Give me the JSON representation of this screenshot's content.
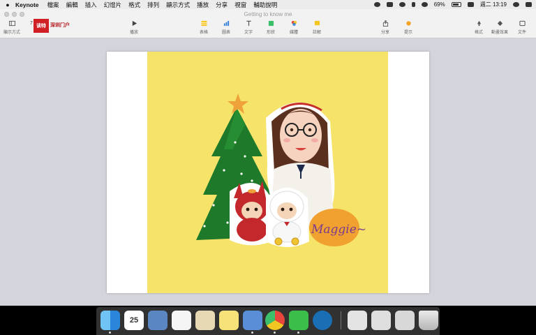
{
  "menubar": {
    "apple": "",
    "app": "Keynote",
    "menus": [
      "檔案",
      "編輯",
      "插入",
      "幻燈片",
      "格式",
      "排列",
      "顯示方式",
      "播放",
      "分享",
      "視窗",
      "輔助說明"
    ],
    "battery": "69%",
    "clock": "週二 13:19"
  },
  "window": {
    "title": "Getting to know me",
    "toolbar": {
      "view": "顯示方式",
      "play": "播放",
      "table": "表格",
      "chart": "圖表",
      "text": "文字",
      "shape": "形狀",
      "media": "媒體",
      "comment": "註解",
      "share": "分享",
      "tips": "提示",
      "format": "格式",
      "animate": "動畫效果",
      "document": "文件"
    },
    "logo": {
      "number": "7",
      "brand_box": "读特",
      "brand_text": "深圳门户"
    }
  },
  "slide": {
    "signature": "Maggie~"
  },
  "dock": {
    "calendar_day": "25",
    "apps": [
      "finder",
      "calendar",
      "preview",
      "reminders",
      "textedit",
      "notes",
      "keynote",
      "chrome",
      "wechat",
      "edge",
      "documents",
      "photos",
      "screenshot",
      "trash"
    ]
  }
}
